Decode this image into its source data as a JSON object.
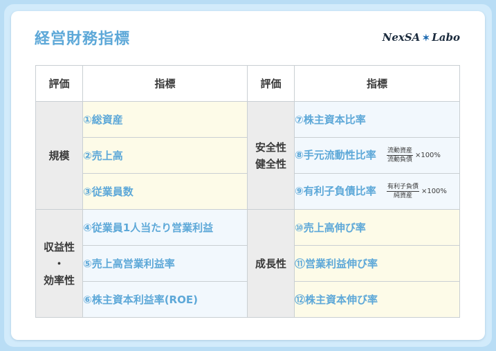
{
  "title": "経営財務指標",
  "logo": {
    "left": "NexSA",
    "star": "✶",
    "right": "Labo"
  },
  "headers": {
    "eval": "評価",
    "indicator": "指標"
  },
  "groups": {
    "scale": "規模",
    "safety": [
      "安全性",
      "健全性"
    ],
    "profit": [
      "収益性",
      "・",
      "効率性"
    ],
    "growth": "成長性"
  },
  "left_items": [
    "①総資産",
    "②売上高",
    "③従業員数",
    "④従業員1人当たり営業利益",
    "⑤売上高営業利益率",
    "⑥株主資本利益率(ROE)"
  ],
  "right_items": [
    "⑦株主資本比率",
    "⑧手元流動性比率",
    "⑨有利子負債比率",
    "⑩売上高伸び率",
    "⑪営業利益伸び率",
    "⑫株主資本伸び率"
  ],
  "formulas": {
    "item8": {
      "numerator": "流動資産",
      "denominator": "流動負債",
      "multiplier": "×100%"
    },
    "item9": {
      "numerator": "有利子負債",
      "denominator": "純資産",
      "multiplier": "×100%"
    }
  },
  "colors": {
    "accent": "#5da8d8",
    "yellow_cell": "#fdfbe8",
    "blue_cell": "#f2f8fd",
    "eval_cell": "#ececec"
  }
}
